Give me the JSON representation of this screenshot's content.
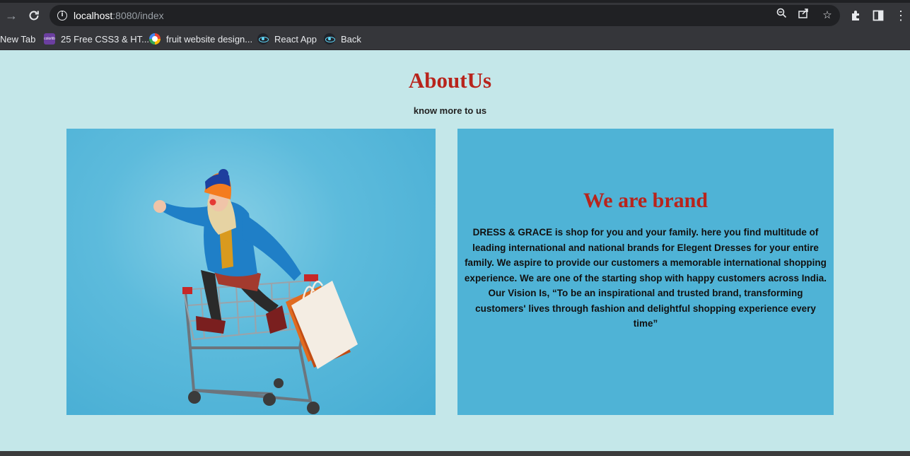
{
  "browser": {
    "url_host": "localhost",
    "url_rest": ":8080/index",
    "bookmarks": [
      {
        "label": "New Tab",
        "icon": "none"
      },
      {
        "label": "25 Free CSS3 & HT...",
        "icon": "colorlib-icon"
      },
      {
        "label": "fruit website design...",
        "icon": "google-icon"
      },
      {
        "label": "React App",
        "icon": "react-icon"
      },
      {
        "label": "Back",
        "icon": "react-icon"
      }
    ],
    "colors": {
      "toolbar": "#35363a",
      "omnibox": "#202124"
    }
  },
  "page": {
    "title": "AboutUs",
    "subtitle": "know more to us",
    "brand_title": "We are brand",
    "brand_paragraph": "DRESS & GRACE is shop for you and your family. here you find multitude of leading international and national brands for Elegent Dresses for your entire family. We aspire to provide our customers a memorable international shopping experience. We are one of the starting shop with happy customers across India.",
    "brand_vision": "Our Vision Is, “To be an inspirational and trusted brand, transforming customers' lives through fashion and delightful shopping experience every time”",
    "colors": {
      "background": "#c4e7e9",
      "accent": "#b8241c",
      "card": "#4fb3d6"
    }
  }
}
